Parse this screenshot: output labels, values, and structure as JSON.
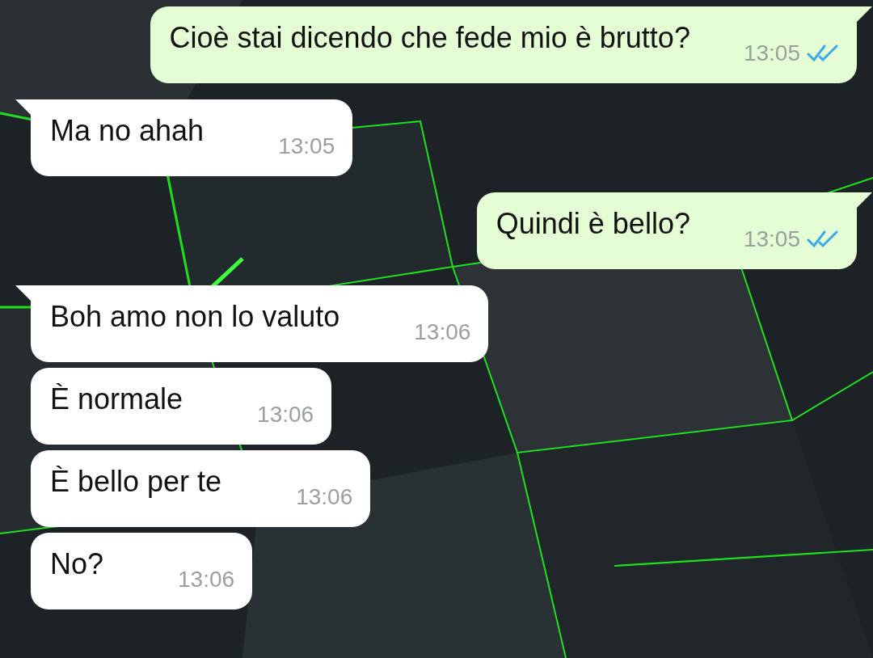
{
  "messages": [
    {
      "kind": "outgoing",
      "text": "Cioè stai dicendo che fede mio è brutto?",
      "time": "13:05",
      "tail": true,
      "read": true
    },
    {
      "kind": "incoming",
      "text": "Ma no ahah",
      "time": "13:05",
      "tail": true
    },
    {
      "kind": "outgoing",
      "text": "Quindi è bello?",
      "time": "13:05",
      "tail": true,
      "read": true
    },
    {
      "kind": "incoming",
      "text": "Boh amo non lo valuto",
      "time": "13:06",
      "tail": true
    },
    {
      "kind": "incoming",
      "text": "È normale",
      "time": "13:06",
      "tail": false
    },
    {
      "kind": "incoming",
      "text": "È bello per te",
      "time": "13:06",
      "tail": false
    },
    {
      "kind": "incoming",
      "text": "No?",
      "time": "13:06",
      "tail": false
    }
  ]
}
